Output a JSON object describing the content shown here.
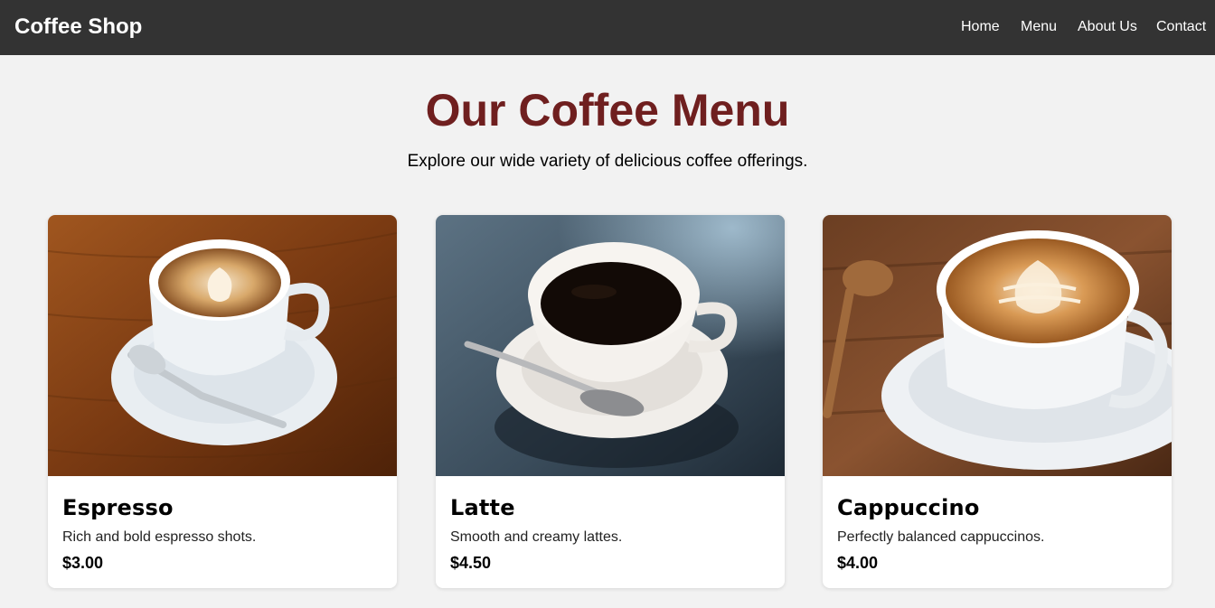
{
  "header": {
    "brand": "Coffee Shop",
    "nav": [
      "Home",
      "Menu",
      "About Us",
      "Contact"
    ]
  },
  "hero": {
    "title": "Our Coffee Menu",
    "subtitle": "Explore our wide variety of delicious coffee offerings."
  },
  "menu": [
    {
      "name": "Espresso",
      "description": "Rich and bold espresso shots.",
      "price": "$3.00",
      "image": "espresso-cup-on-wooden-table"
    },
    {
      "name": "Latte",
      "description": "Smooth and creamy lattes.",
      "price": "$4.50",
      "image": "black-coffee-cup-on-dark-table"
    },
    {
      "name": "Cappuccino",
      "description": "Perfectly balanced cappuccinos.",
      "price": "$4.00",
      "image": "cappuccino-latte-art-on-saucer"
    }
  ],
  "colors": {
    "navbar": "#333333",
    "page_background": "#f2f2f2",
    "title": "#6f1f1f",
    "card_background": "#ffffff"
  }
}
